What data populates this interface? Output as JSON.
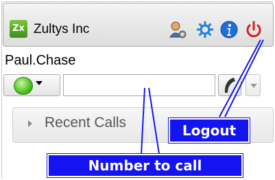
{
  "header": {
    "logo_text": "Zx",
    "company_name": "Zultys Inc",
    "icons": [
      "user-settings-icon",
      "gear-icon",
      "info-icon",
      "power-icon"
    ]
  },
  "user": {
    "name": "Paul.Chase"
  },
  "status": {
    "state_color": "#49c21a"
  },
  "dialer": {
    "number_value": "",
    "number_placeholder": ""
  },
  "recent_calls": {
    "label": "Recent Calls"
  },
  "annotations": {
    "logout": "Logout",
    "number_to_call": "Number to call"
  },
  "colors": {
    "callout_blue": "#1414f0",
    "power_red": "#d42020",
    "gear_blue": "#1f7fe0"
  }
}
